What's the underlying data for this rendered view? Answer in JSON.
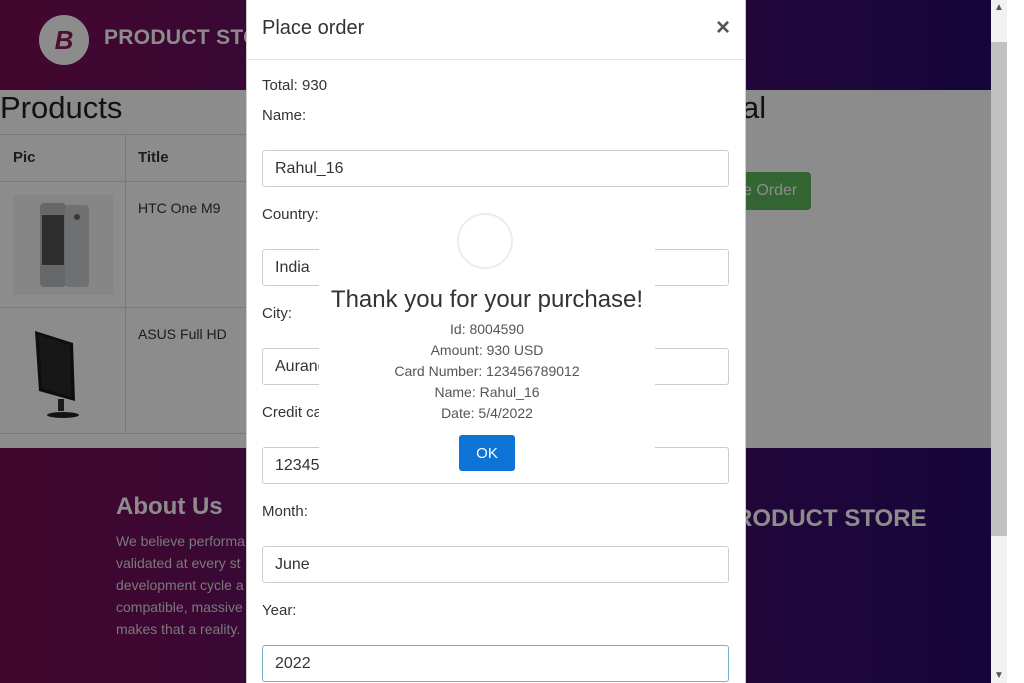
{
  "header": {
    "brand": "PRODUCT STORE",
    "logo_letter": "B"
  },
  "products": {
    "title": "Products",
    "columns": [
      "Pic",
      "Title"
    ],
    "rows": [
      {
        "title": "HTC One M9"
      },
      {
        "title": "ASUS Full HD"
      }
    ],
    "right_title": "al",
    "place_order_label": "e Order"
  },
  "footer": {
    "about_title": "About Us",
    "about_lines": [
      "We believe performa",
      "validated at every st",
      "development cycle a",
      "compatible, massive",
      "makes that a reality."
    ],
    "brand": "RODUCT STORE"
  },
  "modal": {
    "title": "Place order",
    "close": "×",
    "total": "Total: 930",
    "fields": [
      {
        "label": "Name:",
        "value": "Rahul_16"
      },
      {
        "label": "Country:",
        "value": "India"
      },
      {
        "label": "City:",
        "value": "Aurang"
      },
      {
        "label": "Credit ca",
        "value": "12345"
      },
      {
        "label": "Month:",
        "value": "June"
      },
      {
        "label": "Year:",
        "value": "2022"
      }
    ]
  },
  "alert": {
    "title": "Thank you for your purchase!",
    "lines": [
      "Id: 8004590",
      "Amount: 930 USD",
      "Card Number: 123456789012",
      "Name: Rahul_16",
      "Date: 5/4/2022"
    ],
    "ok_label": "OK"
  }
}
